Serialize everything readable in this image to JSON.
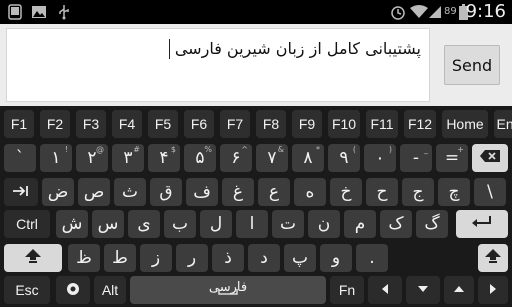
{
  "statusbar": {
    "icons": [
      "tablet-icon",
      "image-icon",
      "usb-icon",
      "alarm-icon",
      "wifi-icon",
      "signal-icon",
      "battery-icon"
    ],
    "battery_level": "89",
    "time": "9:16"
  },
  "editor": {
    "text": "پشتیبانی کامل از زبان شیرین فارسی",
    "send_label": "Send"
  },
  "keyboard": {
    "function_row": [
      "F1",
      "F2",
      "F3",
      "F4",
      "F5",
      "F6",
      "F7",
      "F8",
      "F9",
      "F10",
      "F11",
      "F12",
      "Home",
      "End"
    ],
    "number_row": [
      {
        "label": "`",
        "hint": ""
      },
      {
        "label": "۱",
        "hint": "!"
      },
      {
        "label": "۲",
        "hint": "@"
      },
      {
        "label": "۳",
        "hint": "#"
      },
      {
        "label": "۴",
        "hint": "$"
      },
      {
        "label": "۵",
        "hint": "%"
      },
      {
        "label": "۶",
        "hint": "^"
      },
      {
        "label": "۷",
        "hint": "&"
      },
      {
        "label": "۸",
        "hint": "*"
      },
      {
        "label": "۹",
        "hint": "("
      },
      {
        "label": "۰",
        "hint": ")"
      },
      {
        "label": "-",
        "hint": "_"
      },
      {
        "label": "=",
        "hint": "+"
      }
    ],
    "row2": [
      "ض",
      "ص",
      "ث",
      "ق",
      "ف",
      "غ",
      "ع",
      "ه",
      "خ",
      "ح",
      "ج",
      "چ",
      "\\"
    ],
    "row3": [
      "ش",
      "س",
      "ی",
      "ب",
      "ل",
      "ا",
      "ت",
      "ن",
      "م",
      "ک",
      "گ"
    ],
    "row4": [
      "ظ",
      "ط",
      "ز",
      "ر",
      "ذ",
      "د",
      "پ",
      "و",
      "."
    ],
    "ctrl_label": "Ctrl",
    "esc_label": "Esc",
    "alt_label": "Alt",
    "fn_label": "Fn",
    "space_label": "فارسی",
    "colors": {
      "key": "#3c3c3c",
      "background": "#1a1a1a",
      "text": "#f2f2f2"
    }
  }
}
